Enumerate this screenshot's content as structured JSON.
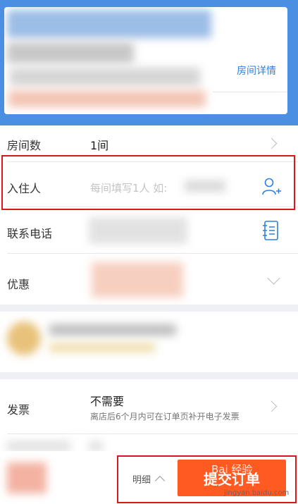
{
  "room_card": {
    "detail_link": "房间详情"
  },
  "form": {
    "rooms": {
      "label": "房间数",
      "value": "1间"
    },
    "guests": {
      "label": "入住人",
      "placeholder": "每间填写1人 如:"
    },
    "phone": {
      "label": "联系电话"
    },
    "discount": {
      "label": "优惠"
    },
    "invoice": {
      "label": "发票",
      "value": "不需要",
      "note": "离店后6个月内可在订单页补开电子发票"
    }
  },
  "bottom": {
    "details_label": "明细",
    "submit_label": "提交订单",
    "watermark": "Bai 经验",
    "watermark_url": "jingyan.baidu.com"
  },
  "colors": {
    "header": "#4a8fe2",
    "accent_link": "#2f7fe0",
    "submit": "#ff5a22",
    "highlight": "#d9181d"
  }
}
